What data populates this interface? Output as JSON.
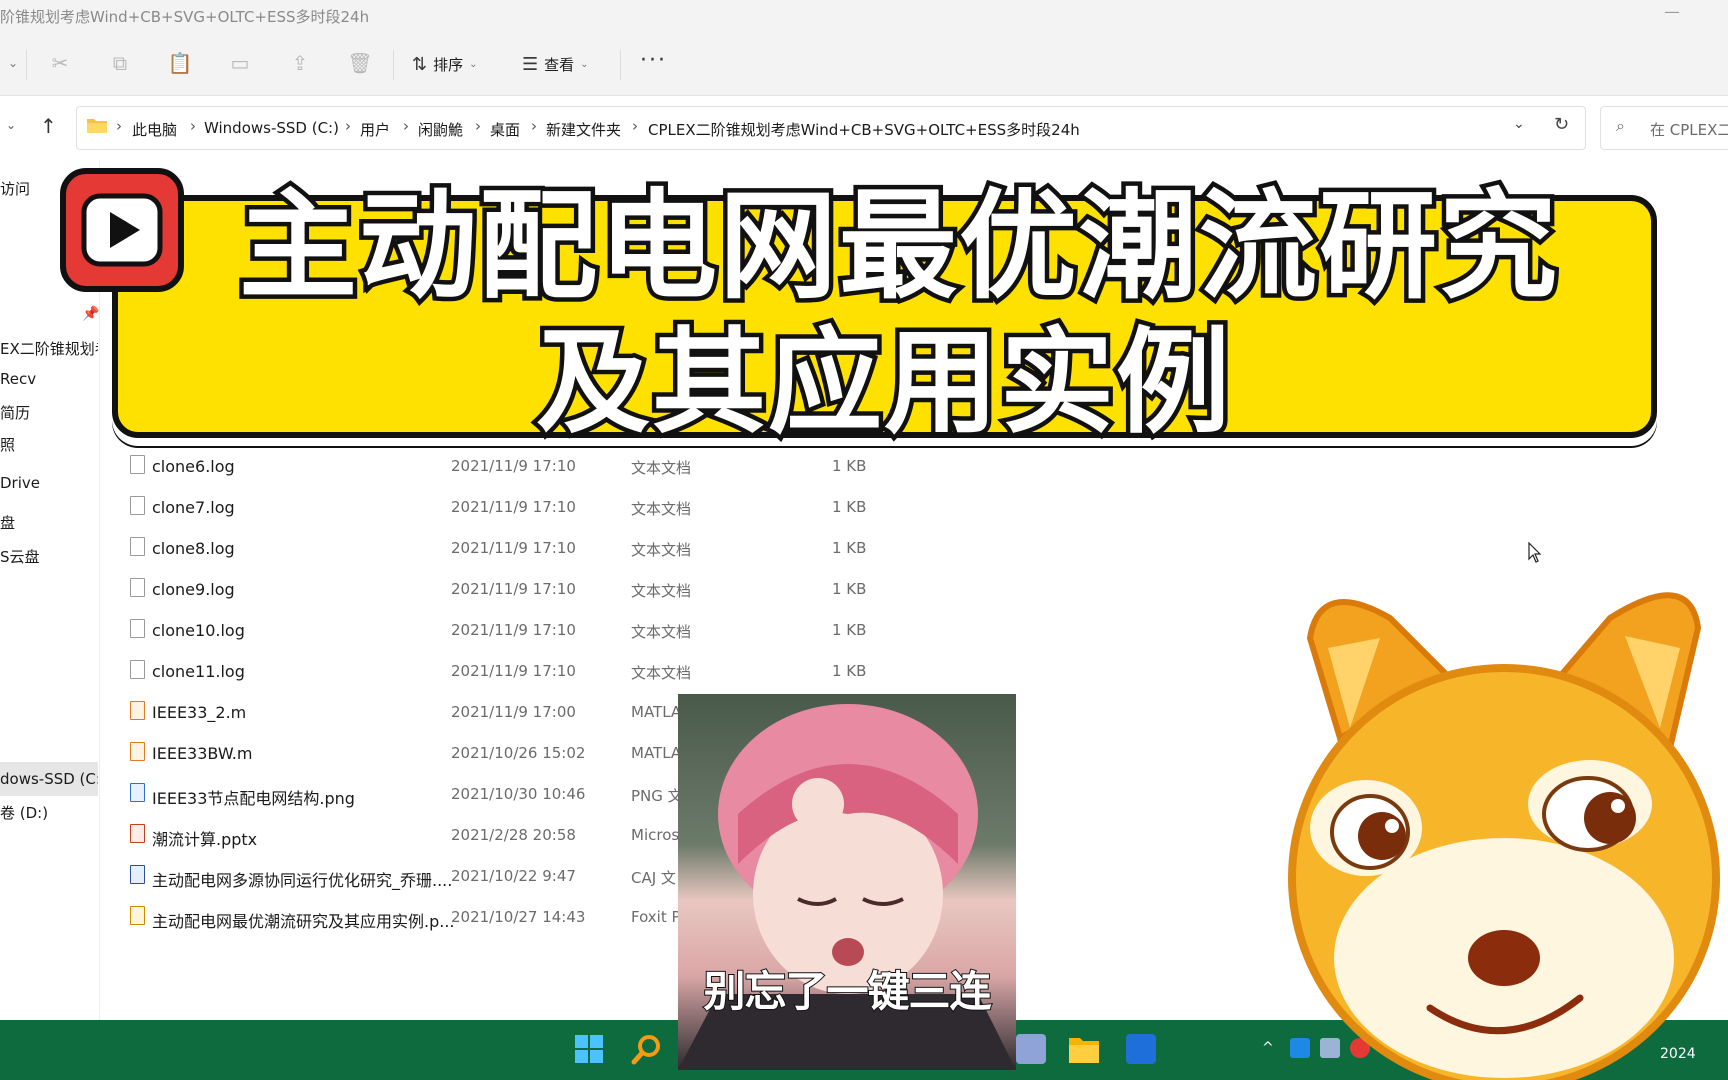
{
  "window": {
    "title": "阶锥规划考虑Wind+CB+SVG+OLTC+ESS多时段24h",
    "minimize_glyph": "—"
  },
  "toolbar": {
    "sort_label": "排序",
    "view_label": "查看",
    "more_label": "···"
  },
  "breadcrumb": {
    "items": [
      "此电脑",
      "Windows-SSD (C:)",
      "用户",
      "闲鼩鮠",
      "桌面",
      "新建文件夹",
      "CPLEX二阶锥规划考虑Wind+CB+SVG+OLTC+ESS多时段24h"
    ],
    "separator": "›"
  },
  "search": {
    "placeholder": "在 CPLEX二"
  },
  "nav": {
    "items": [
      "访问",
      "EX二阶锥规划考",
      "Recv",
      "简历",
      "照",
      "Drive",
      "盘",
      "S云盘",
      "dows-SSD (C:)",
      "卷 (D:)"
    ]
  },
  "files": [
    {
      "name": "clone6.log",
      "date": "2021/11/9 17:10",
      "type": "文本文档",
      "size": "1 KB",
      "icon": "text-file-icon"
    },
    {
      "name": "clone7.log",
      "date": "2021/11/9 17:10",
      "type": "文本文档",
      "size": "1 KB",
      "icon": "text-file-icon"
    },
    {
      "name": "clone8.log",
      "date": "2021/11/9 17:10",
      "type": "文本文档",
      "size": "1 KB",
      "icon": "text-file-icon"
    },
    {
      "name": "clone9.log",
      "date": "2021/11/9 17:10",
      "type": "文本文档",
      "size": "1 KB",
      "icon": "text-file-icon"
    },
    {
      "name": "clone10.log",
      "date": "2021/11/9 17:10",
      "type": "文本文档",
      "size": "1 KB",
      "icon": "text-file-icon"
    },
    {
      "name": "clone11.log",
      "date": "2021/11/9 17:10",
      "type": "文本文档",
      "size": "1 KB",
      "icon": "text-file-icon"
    },
    {
      "name": "IEEE33_2.m",
      "date": "2021/11/9 17:00",
      "type": "MATLA",
      "size": "",
      "icon": "matlab-file-icon"
    },
    {
      "name": "IEEE33BW.m",
      "date": "2021/10/26 15:02",
      "type": "MATLA",
      "size": "",
      "icon": "matlab-file-icon"
    },
    {
      "name": "IEEE33节点配电网结构.png",
      "date": "2021/10/30 10:46",
      "type": "PNG 文",
      "size": "",
      "icon": "image-file-icon"
    },
    {
      "name": "潮流计算.pptx",
      "date": "2021/2/28 20:58",
      "type": "Micros",
      "size": "",
      "icon": "powerpoint-file-icon"
    },
    {
      "name": "主动配电网多源协同运行优化研究_乔珊....",
      "date": "2021/10/22 9:47",
      "type": "CAJ 文",
      "size": "",
      "icon": "caj-file-icon"
    },
    {
      "name": "主动配电网最优潮流研究及其应用实例.p...",
      "date": "2021/10/27 14:43",
      "type": "Foxit P",
      "size": "",
      "icon": "pdf-file-icon"
    }
  ],
  "banner": {
    "line1": "主动配电网最优潮流研究",
    "line2": "及其应用实例"
  },
  "sticker": {
    "caption": "别忘了一键三连"
  },
  "taskbar": {
    "clock_partial": "2024"
  },
  "colors": {
    "banner_yellow": "#ffe100",
    "taskbar_green": "#0e6b3e",
    "play_red": "#e53935",
    "doge_orange": "#f2a21e"
  }
}
